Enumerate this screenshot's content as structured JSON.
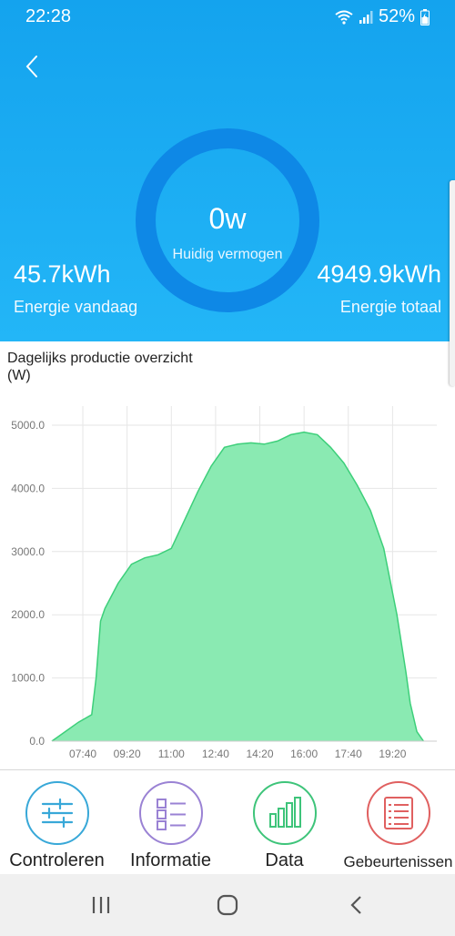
{
  "status_bar": {
    "time": "22:28",
    "battery": "52%"
  },
  "icons": {
    "back": "chevron-left-icon",
    "wifi": "wifi-icon",
    "signal": "signal-icon",
    "battery": "battery-icon"
  },
  "power": {
    "value": "0w",
    "label": "Huidig vermogen"
  },
  "energy_today": {
    "value": "45.7kWh",
    "label": "Energie vandaag"
  },
  "energy_total": {
    "value": "4949.9kWh",
    "label": "Energie totaal"
  },
  "chart_title_line1": "Dagelijks productie overzicht",
  "chart_title_line2": "(W)",
  "colors": {
    "header": "#1aa8f2",
    "ring": "#0e88e6",
    "fill": "#8aeab2",
    "stroke": "#3dcf7a"
  },
  "chart_data": {
    "type": "area",
    "title": "Dagelijks productie overzicht",
    "ylabel": "(W)",
    "xlabel": "",
    "ylim": [
      0,
      5000
    ],
    "yticks": [
      "0.0",
      "1000.0",
      "2000.0",
      "3000.0",
      "4000.0",
      "5000.0"
    ],
    "xticks": [
      "07:40",
      "09:20",
      "11:00",
      "12:40",
      "14:20",
      "16:00",
      "17:40",
      "19:20"
    ],
    "grid": true,
    "x": [
      "06:30",
      "07:00",
      "07:30",
      "08:00",
      "08:10",
      "08:20",
      "08:30",
      "09:00",
      "09:30",
      "10:00",
      "10:30",
      "11:00",
      "11:30",
      "12:00",
      "12:30",
      "13:00",
      "13:30",
      "14:00",
      "14:30",
      "15:00",
      "15:30",
      "16:00",
      "16:30",
      "17:00",
      "17:30",
      "18:00",
      "18:30",
      "19:00",
      "19:30",
      "19:50",
      "20:00",
      "20:15",
      "20:30"
    ],
    "values": [
      0,
      150,
      300,
      420,
      1000,
      1900,
      2100,
      2500,
      2800,
      2900,
      2950,
      3050,
      3500,
      3950,
      4350,
      4650,
      4700,
      4720,
      4700,
      4750,
      4850,
      4890,
      4850,
      4650,
      4400,
      4050,
      3650,
      3050,
      2000,
      1100,
      600,
      150,
      0
    ]
  },
  "nav": [
    {
      "label": "Controleren",
      "icon": "sliders-icon",
      "color": "#38a8d8"
    },
    {
      "label": "Informatie",
      "icon": "list-grid-icon",
      "color": "#9a82d4"
    },
    {
      "label": "Data",
      "icon": "bar-chart-icon",
      "color": "#3ec47a"
    },
    {
      "label": "Gebeurtenissen",
      "icon": "event-list-icon",
      "color": "#e06060"
    }
  ],
  "system_nav": {
    "recent": "recent-apps-icon",
    "home": "home-icon",
    "back": "system-back-icon"
  }
}
